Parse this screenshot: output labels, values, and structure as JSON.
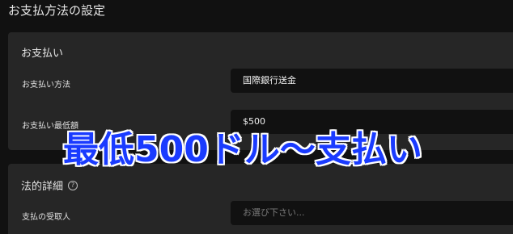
{
  "page": {
    "title": "お支払方法の設定"
  },
  "payment_section": {
    "title": "お支払い",
    "method_label": "お支払い方法",
    "method_value": "国際銀行送金",
    "minimum_label": "お支払い最低額",
    "minimum_value": "$500"
  },
  "legal_section": {
    "title": "法的詳細",
    "help_icon": "?",
    "recipient_label": "支払の受取人",
    "recipient_placeholder": "お選び下さい..."
  },
  "overlay": {
    "caption": "最低500ドル〜支払い"
  },
  "colors": {
    "background": "#111111",
    "panel": "#262626",
    "field": "#111111",
    "overlay_text": "#1a3bff",
    "overlay_outline": "#ffffff"
  }
}
